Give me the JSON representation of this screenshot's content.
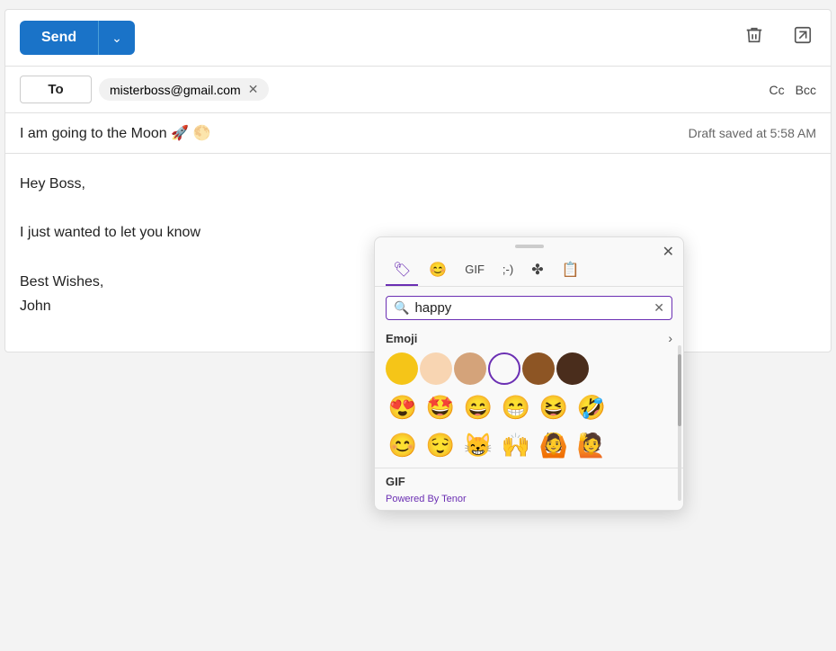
{
  "toolbar": {
    "send_label": "Send",
    "dropdown_arrow": "⌄",
    "delete_icon": "🗑",
    "popout_icon": "⬡"
  },
  "to_row": {
    "to_label": "To",
    "recipient_email": "misterboss@gmail.com",
    "cc_label": "Cc",
    "bcc_label": "Bcc"
  },
  "subject_row": {
    "subject_text": "I am going to the Moon 🚀 🌕",
    "draft_status": "Draft saved at 5:58 AM"
  },
  "body": {
    "line1": "Hey Boss,",
    "line2": "I just wanted to let you know",
    "line3": "Best Wishes,",
    "line4": "John"
  },
  "emoji_picker": {
    "close_label": "✕",
    "tabs": [
      {
        "id": "sticker",
        "label": "🏷️",
        "active": true
      },
      {
        "id": "emoji",
        "label": "😊",
        "active": false
      },
      {
        "id": "gif",
        "label": "GIF",
        "active": false
      },
      {
        "id": "kaomoji",
        "label": ";-)",
        "active": false
      },
      {
        "id": "symbols",
        "label": "⁂",
        "active": false
      },
      {
        "id": "clipboard",
        "label": "📋",
        "active": false
      }
    ],
    "search_placeholder": "happy",
    "search_clear": "✕",
    "section_label": "Emoji",
    "section_arrow": ">",
    "skin_tones": [
      {
        "id": "yellow",
        "class": "skin-yellow"
      },
      {
        "id": "light",
        "class": "skin-light"
      },
      {
        "id": "medium-light",
        "class": "skin-medium-light"
      },
      {
        "id": "selected",
        "class": "skin-selected"
      },
      {
        "id": "medium-dark",
        "class": "skin-medium-dark"
      },
      {
        "id": "dark",
        "class": "skin-dark"
      }
    ],
    "emoji_row1": [
      "😍",
      "🤩",
      "😄",
      "😁",
      "😆",
      "🤣"
    ],
    "emoji_row2": [
      "😊",
      "😌",
      "😸",
      "🙌",
      "🙆",
      "🙋"
    ],
    "gif_label": "GIF",
    "tenor_label": "Powered By Tenor"
  }
}
